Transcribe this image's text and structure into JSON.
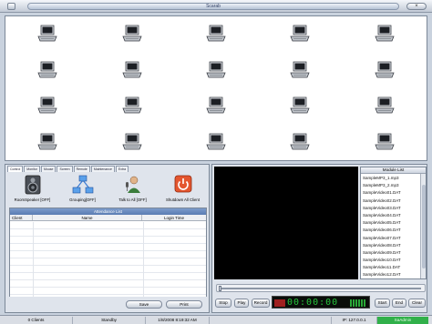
{
  "window": {
    "title": "Scarab"
  },
  "clients": {
    "count": 20,
    "icon": "computer-icon"
  },
  "left_panel": {
    "tabs": [
      "Control",
      "Monitor",
      "Mouse",
      "Screen",
      "Remote",
      "Maintenance",
      "Extra"
    ],
    "actions": [
      {
        "label": "RoomSpeaker [OFF]",
        "icon": "speaker-icon"
      },
      {
        "label": "Grouping[OFF]",
        "icon": "network-icon"
      },
      {
        "label": "Talk to All [OFF]",
        "icon": "microphone-person-icon"
      },
      {
        "label": "Shutdown All Client",
        "icon": "power-icon"
      }
    ],
    "attendance": {
      "title": "Attendance List",
      "columns": [
        "Client",
        "Name",
        "Login Time"
      ]
    },
    "buttons": {
      "save": "Save",
      "print": "Print"
    }
  },
  "right_panel": {
    "module_list": {
      "title": "Module List",
      "items": [
        "SampleMP3_1.mp3",
        "SampleMP3_2.mp3",
        "SampleVideo01.DAT",
        "SampleVideo02.DAT",
        "SampleVideo03.DAT",
        "SampleVideo04.DAT",
        "SampleVideo05.DAT",
        "SampleVideo06.DAT",
        "SampleVideo07.DAT",
        "SampleVideo08.DAT",
        "SampleVideo09.DAT",
        "SampleVideo10.DAT",
        "SampleVideo11.DAT",
        "SampleVideo12.DAT"
      ]
    },
    "controls": {
      "stop": "Stop",
      "play": "Play",
      "record": "Record",
      "start": "Start",
      "end": "End",
      "clear": "Clear"
    },
    "lcd_time": "00:00:00",
    "seek_position": 0
  },
  "status": {
    "clients": "0 Clients",
    "mode": "Standby",
    "datetime": "1/8/2008  8:19:32 AM",
    "ip": "IP: 127.0.0.1",
    "user": "SaAdmin"
  },
  "colors": {
    "status_user_bg": "#31b04a",
    "attendance_header": "#6486bd",
    "lcd_digits": "#26c23a"
  }
}
